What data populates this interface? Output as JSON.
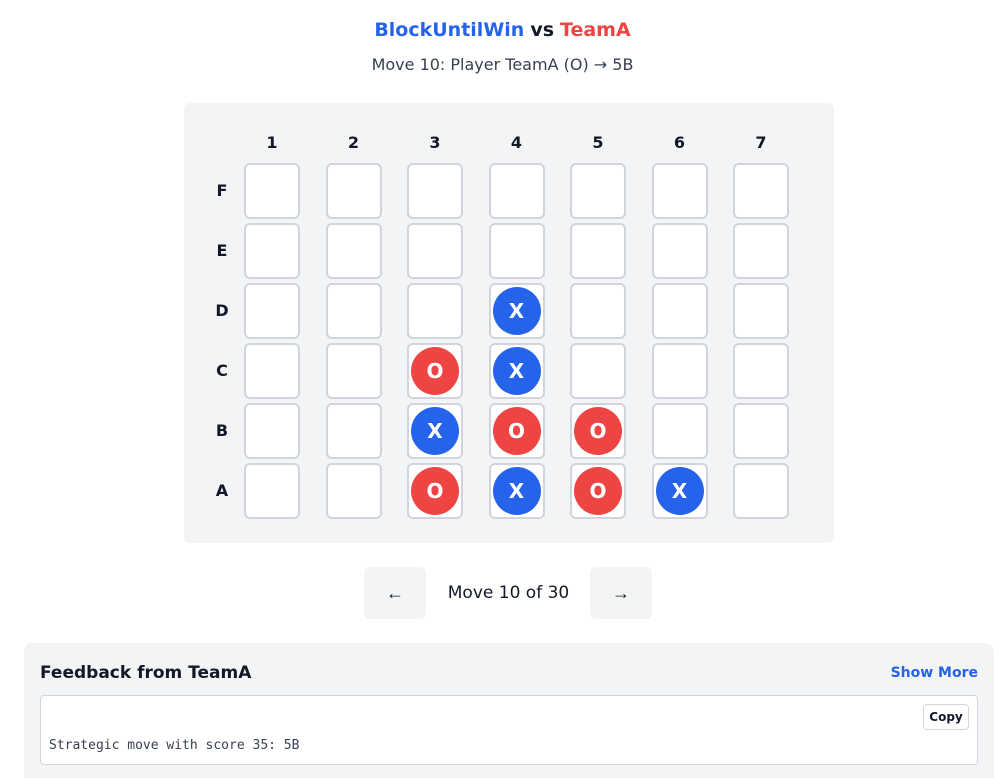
{
  "header": {
    "player1": "BlockUntilWin",
    "vs": "vs",
    "player2": "TeamA",
    "move_description": "Move 10: Player TeamA (O) → 5B"
  },
  "board": {
    "columns": [
      "1",
      "2",
      "3",
      "4",
      "5",
      "6",
      "7"
    ],
    "rows": [
      "F",
      "E",
      "D",
      "C",
      "B",
      "A"
    ],
    "grid": [
      [
        "",
        "",
        "",
        "",
        "",
        "",
        ""
      ],
      [
        "",
        "",
        "",
        "",
        "",
        "",
        ""
      ],
      [
        "",
        "",
        "",
        "X",
        "",
        "",
        ""
      ],
      [
        "",
        "",
        "O",
        "X",
        "",
        "",
        ""
      ],
      [
        "",
        "",
        "X",
        "O",
        "O",
        "",
        ""
      ],
      [
        "",
        "",
        "O",
        "X",
        "O",
        "X",
        ""
      ]
    ],
    "colors": {
      "X": "#2563eb",
      "O": "#ef4444"
    }
  },
  "navigation": {
    "prev_label": "←",
    "next_label": "→",
    "move_counter": "Move 10 of 30"
  },
  "feedback": {
    "title": "Feedback from TeamA",
    "show_more": "Show More",
    "copy_label": "Copy",
    "text": "Strategic move with score 35: 5B"
  }
}
